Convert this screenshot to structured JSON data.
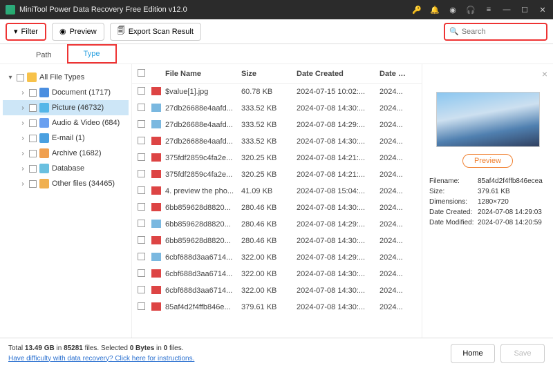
{
  "window": {
    "title": "MiniTool Power Data Recovery Free Edition v12.0"
  },
  "toolbar": {
    "filter": "Filter",
    "preview": "Preview",
    "export": "Export Scan Result",
    "search_placeholder": "Search"
  },
  "tabs": {
    "path": "Path",
    "type": "Type"
  },
  "tree": {
    "root": "All File Types",
    "items": [
      {
        "label": "Document (1717)",
        "cls": "doc"
      },
      {
        "label": "Picture (46732)",
        "cls": "pic",
        "selected": true
      },
      {
        "label": "Audio & Video (684)",
        "cls": "av"
      },
      {
        "label": "E-mail (1)",
        "cls": "em"
      },
      {
        "label": "Archive (1682)",
        "cls": "ar"
      },
      {
        "label": "Database",
        "cls": "db"
      },
      {
        "label": "Other files (34465)",
        "cls": "of"
      }
    ]
  },
  "columns": {
    "name": "File Name",
    "size": "Size",
    "created": "Date Created",
    "modified": "Date Modif"
  },
  "files": [
    {
      "name": "$value[1].jpg",
      "size": "60.78 KB",
      "created": "2024-07-15 10:02:...",
      "mod": "2024...",
      "bad": true
    },
    {
      "name": "27db26688e4aafd...",
      "size": "333.52 KB",
      "created": "2024-07-08 14:30:...",
      "mod": "2024...",
      "bad": false
    },
    {
      "name": "27db26688e4aafd...",
      "size": "333.52 KB",
      "created": "2024-07-08 14:29:...",
      "mod": "2024...",
      "bad": false
    },
    {
      "name": "27db26688e4aafd...",
      "size": "333.52 KB",
      "created": "2024-07-08 14:30:...",
      "mod": "2024...",
      "bad": true
    },
    {
      "name": "375fdf2859c4fa2e...",
      "size": "320.25 KB",
      "created": "2024-07-08 14:21:...",
      "mod": "2024...",
      "bad": true
    },
    {
      "name": "375fdf2859c4fa2e...",
      "size": "320.25 KB",
      "created": "2024-07-08 14:21:...",
      "mod": "2024...",
      "bad": true
    },
    {
      "name": "4. preview the pho...",
      "size": "41.09 KB",
      "created": "2024-07-08 15:04:...",
      "mod": "2024...",
      "bad": true
    },
    {
      "name": "6bb859628d8820...",
      "size": "280.46 KB",
      "created": "2024-07-08 14:30:...",
      "mod": "2024...",
      "bad": true
    },
    {
      "name": "6bb859628d8820...",
      "size": "280.46 KB",
      "created": "2024-07-08 14:29:...",
      "mod": "2024...",
      "bad": false
    },
    {
      "name": "6bb859628d8820...",
      "size": "280.46 KB",
      "created": "2024-07-08 14:30:...",
      "mod": "2024...",
      "bad": true
    },
    {
      "name": "6cbf688d3aa6714...",
      "size": "322.00 KB",
      "created": "2024-07-08 14:29:...",
      "mod": "2024...",
      "bad": false
    },
    {
      "name": "6cbf688d3aa6714...",
      "size": "322.00 KB",
      "created": "2024-07-08 14:30:...",
      "mod": "2024...",
      "bad": true
    },
    {
      "name": "6cbf688d3aa6714...",
      "size": "322.00 KB",
      "created": "2024-07-08 14:30:...",
      "mod": "2024...",
      "bad": true
    },
    {
      "name": "85af4d2f4ffb846e...",
      "size": "379.61 KB",
      "created": "2024-07-08 14:30:...",
      "mod": "2024...",
      "bad": true
    }
  ],
  "preview": {
    "button": "Preview",
    "meta": {
      "filename_k": "Filename:",
      "filename_v": "85af4d2f4ffb846ecea",
      "size_k": "Size:",
      "size_v": "379.61 KB",
      "dim_k": "Dimensions:",
      "dim_v": "1280×720",
      "created_k": "Date Created:",
      "created_v": "2024-07-08 14:29:03",
      "modified_k": "Date Modified:",
      "modified_v": "2024-07-08 14:20:59"
    }
  },
  "footer": {
    "line1a": "Total ",
    "line1b": "13.49 GB",
    "line1c": " in ",
    "line1d": "85281",
    "line1e": " files.   Selected ",
    "line1f": "0 Bytes",
    "line1g": " in ",
    "line1h": "0",
    "line1i": " files.",
    "help": "Have difficulty with data recovery? Click here for instructions.",
    "home": "Home",
    "save": "Save"
  }
}
